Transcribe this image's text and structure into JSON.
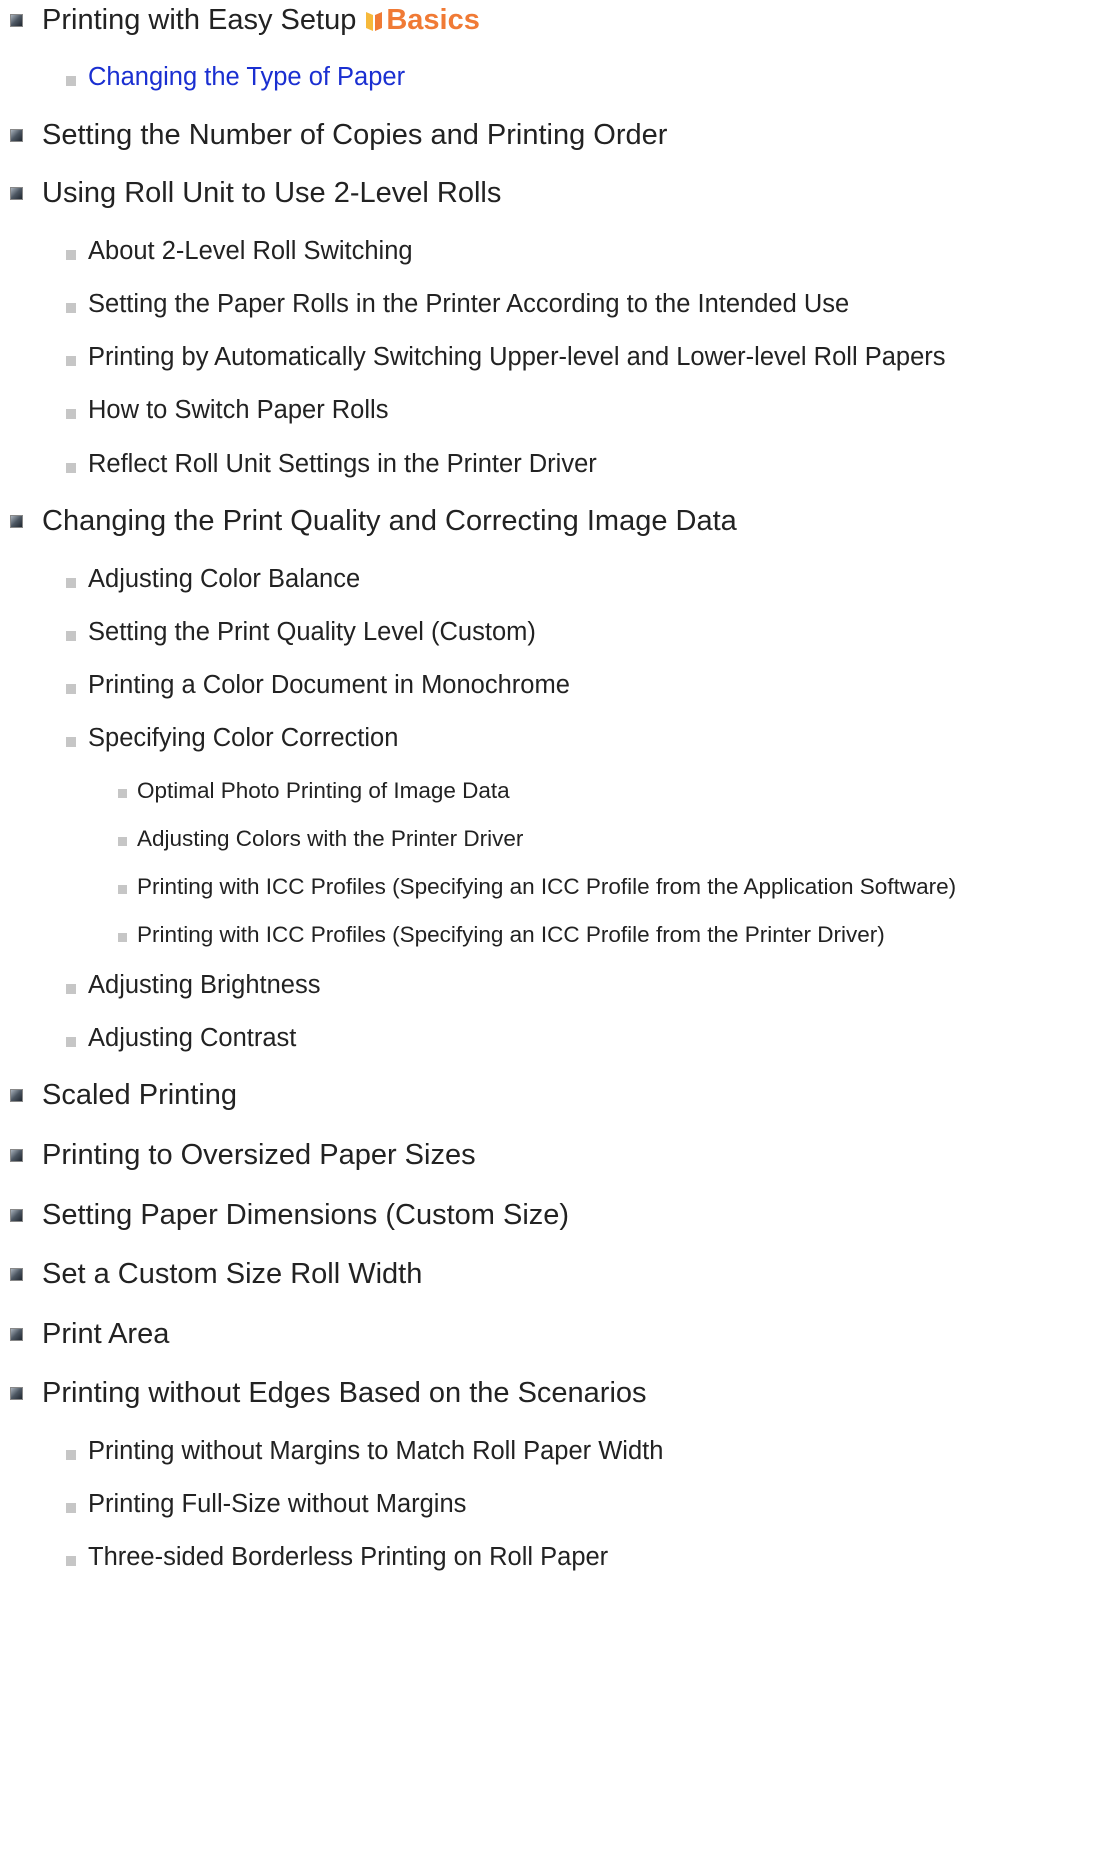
{
  "items": [
    {
      "text": "Printing with Easy Setup",
      "badge": "Basics"
    },
    {
      "text": "Changing the Type of Paper"
    },
    {
      "text": "Setting the Number of Copies and Printing Order"
    },
    {
      "text": "Using Roll Unit to Use 2-Level Rolls"
    },
    {
      "text": "About 2-Level Roll Switching"
    },
    {
      "text": "Setting the Paper Rolls in the Printer According to the Intended Use"
    },
    {
      "text": "Printing by Automatically Switching Upper-level and Lower-level Roll Papers"
    },
    {
      "text": "How to Switch Paper Rolls"
    },
    {
      "text": "Reflect Roll Unit Settings in the Printer Driver"
    },
    {
      "text": "Changing the Print Quality and Correcting Image Data"
    },
    {
      "text": "Adjusting Color Balance"
    },
    {
      "text": "Setting the Print Quality Level (Custom)"
    },
    {
      "text": "Printing a Color Document in Monochrome"
    },
    {
      "text": "Specifying Color Correction"
    },
    {
      "text": "Optimal Photo Printing of Image Data"
    },
    {
      "text": "Adjusting Colors with the Printer Driver"
    },
    {
      "text": "Printing with ICC Profiles (Specifying an ICC Profile from the Application Software)"
    },
    {
      "text": "Printing with ICC Profiles (Specifying an ICC Profile from the Printer Driver)"
    },
    {
      "text": "Adjusting Brightness"
    },
    {
      "text": "Adjusting Contrast"
    },
    {
      "text": "Scaled Printing"
    },
    {
      "text": "Printing to Oversized Paper Sizes"
    },
    {
      "text": "Setting Paper Dimensions (Custom Size)"
    },
    {
      "text": "Set a Custom Size Roll Width"
    },
    {
      "text": "Print Area"
    },
    {
      "text": "Printing without Edges Based on the Scenarios"
    },
    {
      "text": "Printing without Margins to Match Roll Paper Width"
    },
    {
      "text": "Printing Full-Size without Margins"
    },
    {
      "text": "Three-sided Borderless Printing on Roll Paper"
    }
  ],
  "colors": {
    "link": "#1a2fd1",
    "text": "#222222",
    "badge": "#f07a35"
  },
  "icons": {
    "level1_bullet": "square-bullet-icon",
    "level2_bullet": "small-square-bullet-icon",
    "badge_icon": "book-icon"
  }
}
